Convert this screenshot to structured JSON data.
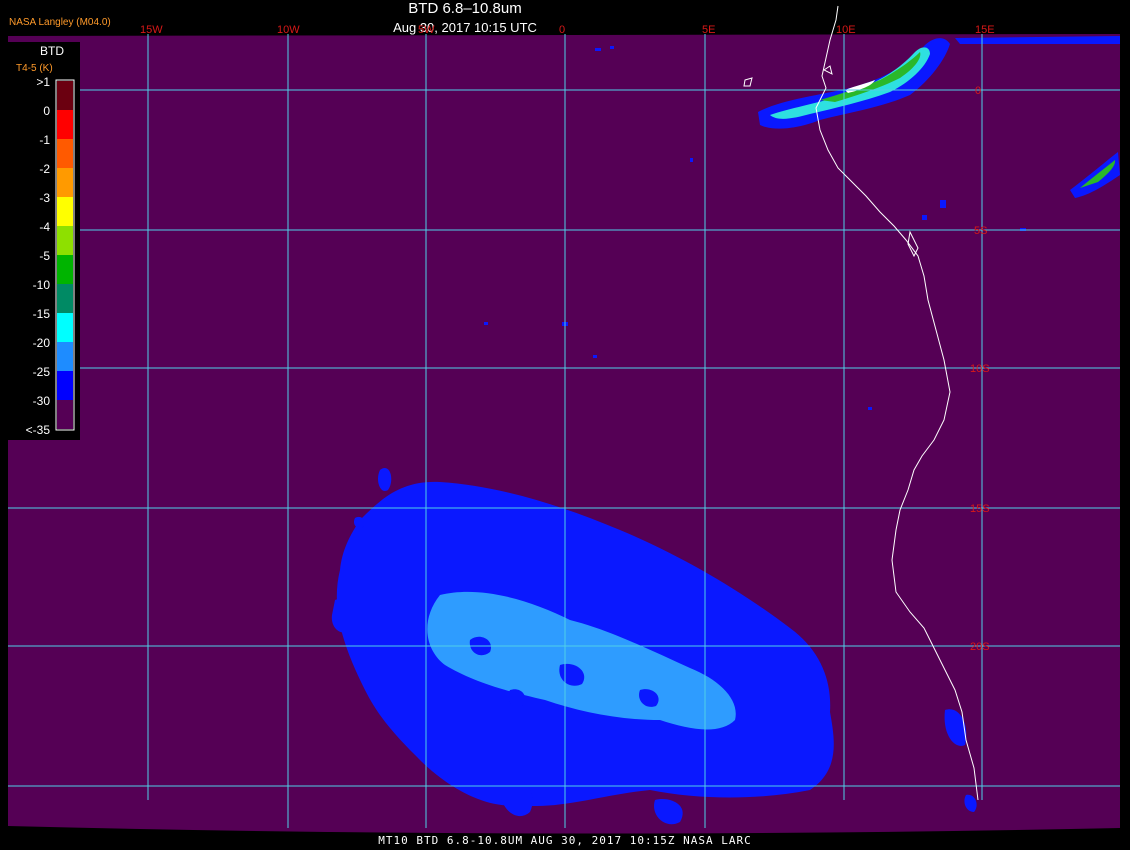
{
  "header": {
    "title": "BTD 6.8–10.8um",
    "subtitle": "Aug 30, 2017 10:15 UTC",
    "credit": "NASA Langley (M04.0)"
  },
  "footer": {
    "text": "MT10  BTD 6.8-10.8UM  AUG 30, 2017 10:15Z  NASA LARC"
  },
  "legend": {
    "title": "BTD",
    "unit": "T4-5 (K)",
    "entries": [
      {
        "label": ">1",
        "color": "#6b0010"
      },
      {
        "label": "0",
        "color": "#ff0000"
      },
      {
        "label": "-1",
        "color": "#ff5a00"
      },
      {
        "label": "-2",
        "color": "#ff9a00"
      },
      {
        "label": "-3",
        "color": "#ffff00"
      },
      {
        "label": "-4",
        "color": "#8ee000"
      },
      {
        "label": "-5",
        "color": "#00b400"
      },
      {
        "label": "-10",
        "color": "#008a64"
      },
      {
        "label": "-15",
        "color": "#00ffff"
      },
      {
        "label": "-20",
        "color": "#1e8cff"
      },
      {
        "label": "-25",
        "color": "#0000ff"
      },
      {
        "label": "-30",
        "color": "#550055"
      },
      {
        "label": "<-35",
        "color": ""
      }
    ]
  },
  "grid": {
    "longitude_labels": [
      "15W",
      "10W",
      "5W",
      "0",
      "5E",
      "10E",
      "15E"
    ],
    "latitude_labels": [
      "0",
      "5S",
      "10S",
      "15S",
      "20S"
    ]
  },
  "colors": {
    "background": "#550055",
    "grid": "#4fd0e8",
    "coast": "#ffffff",
    "cloud_low": "#0a18ff",
    "cloud_mid": "#2e9cff"
  }
}
